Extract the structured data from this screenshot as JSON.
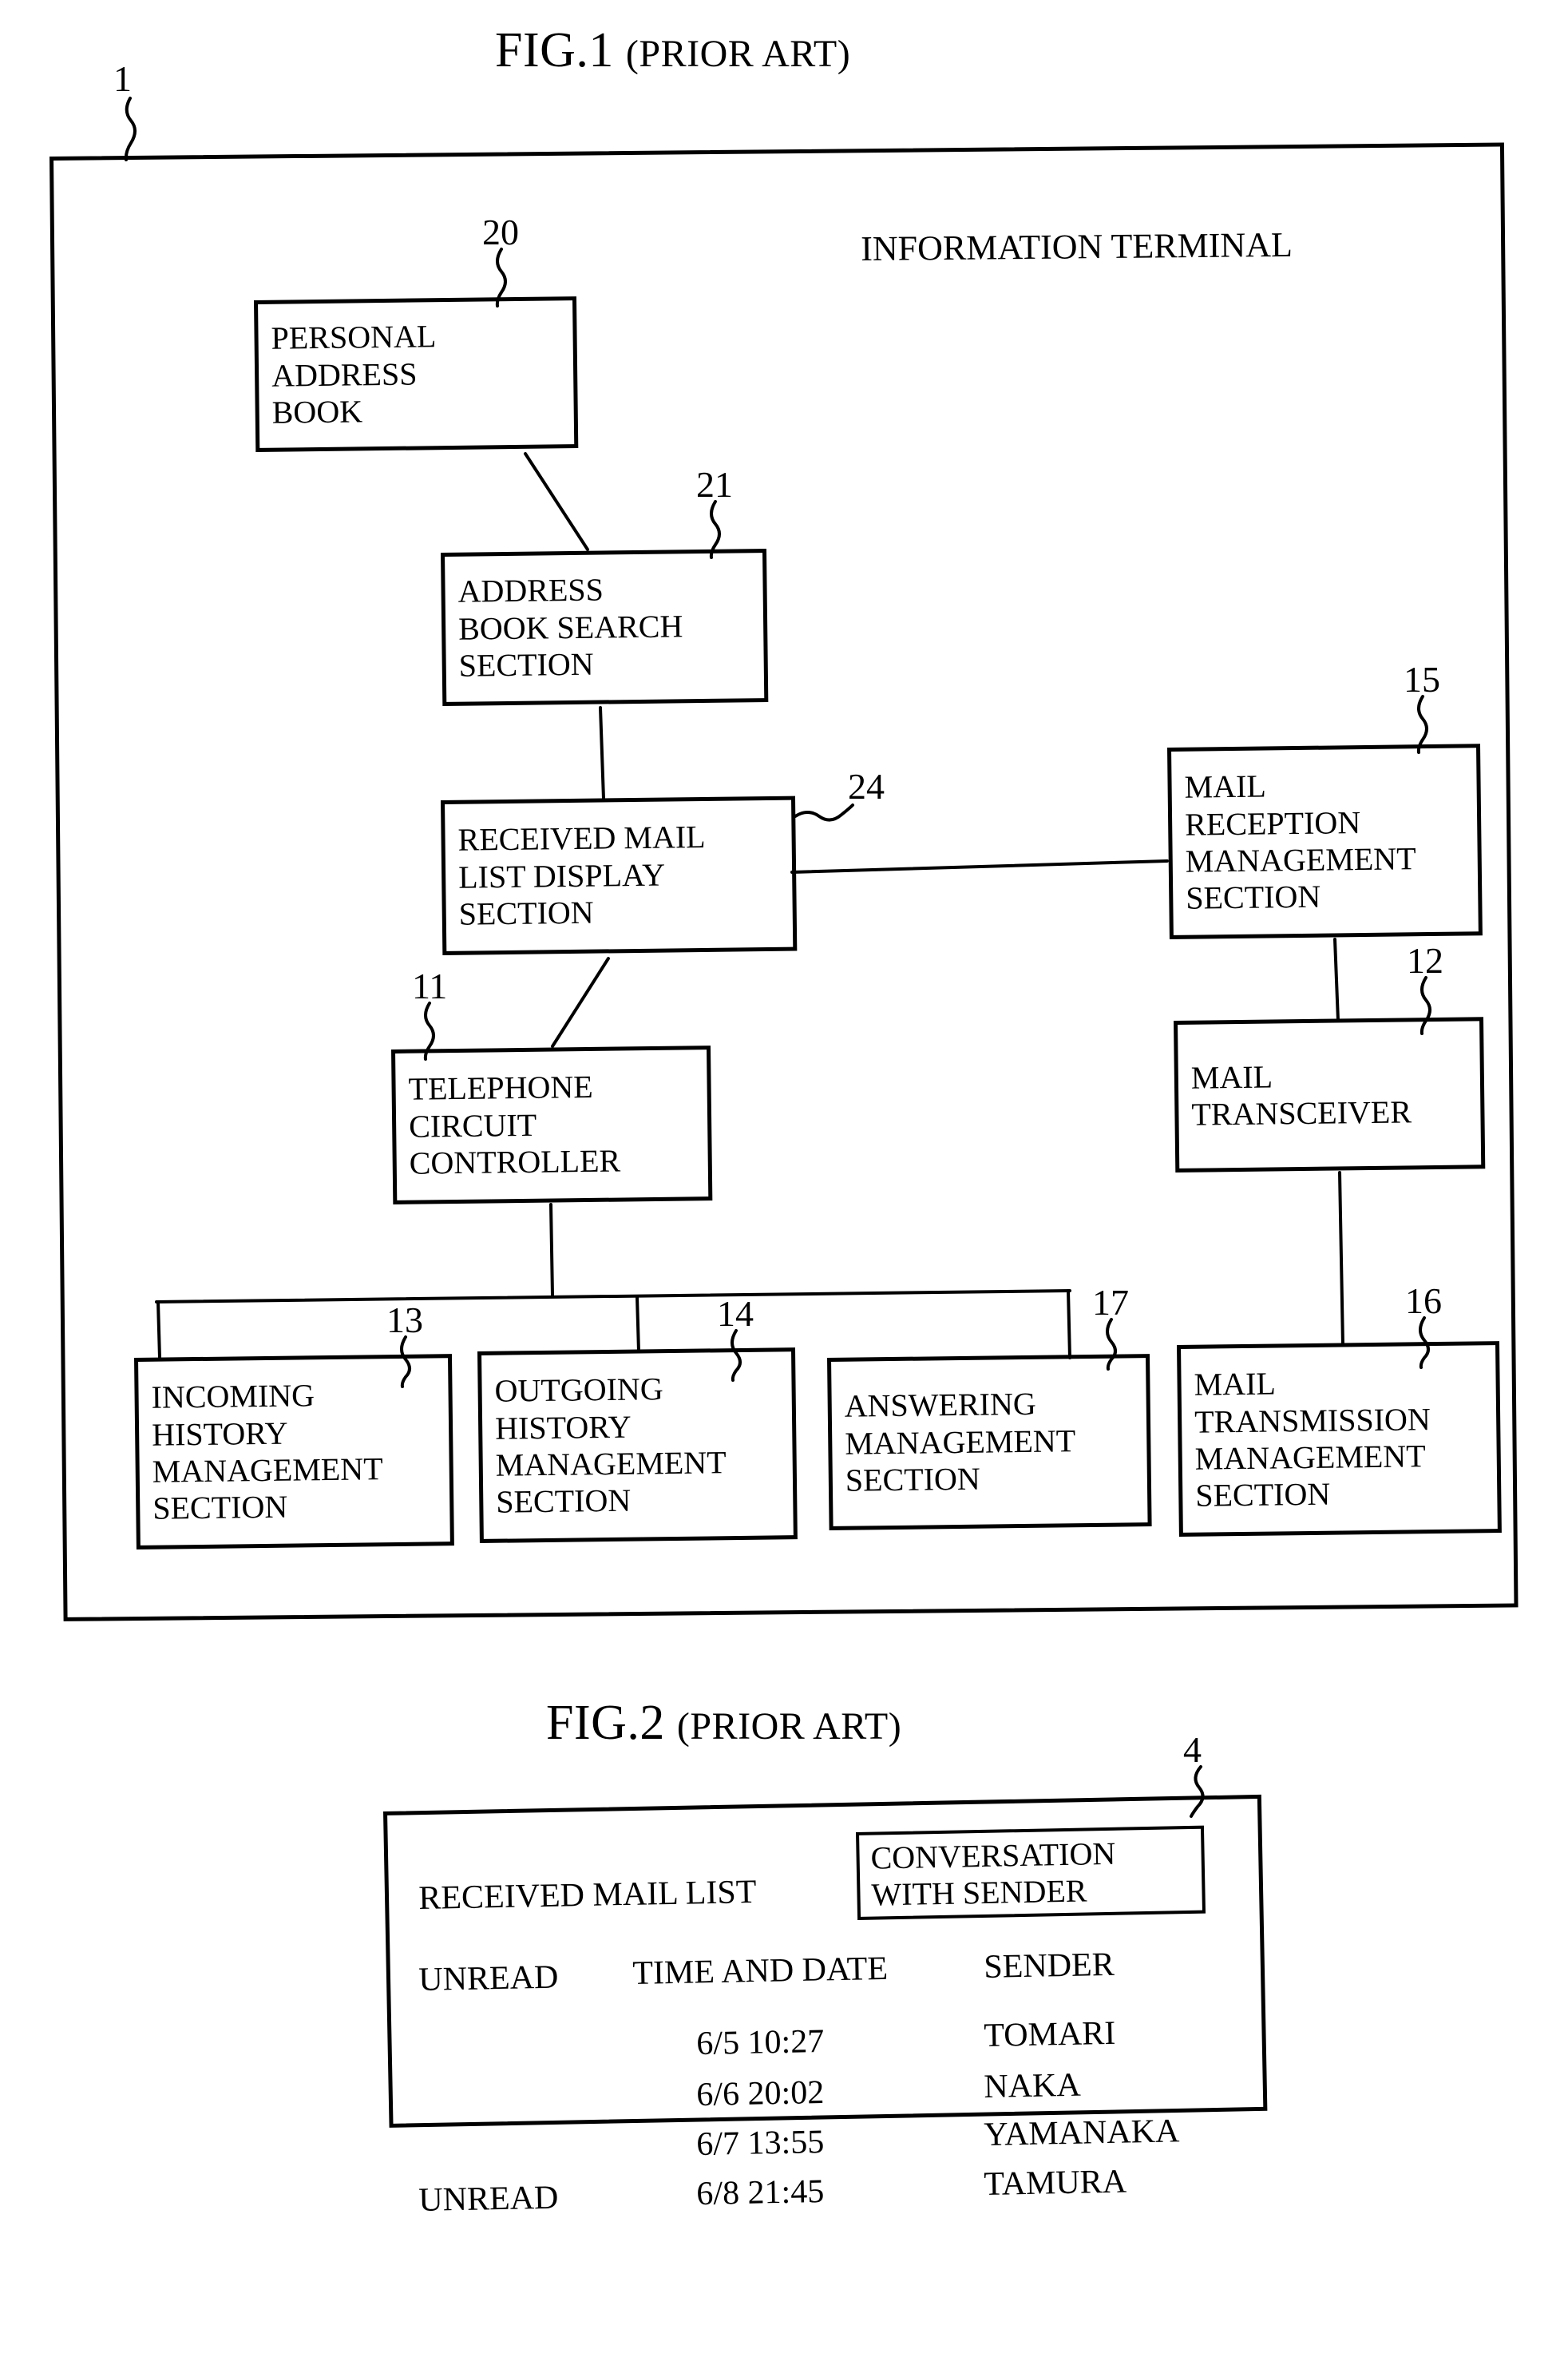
{
  "figures": [
    {
      "id": "fig1",
      "title_number": "FIG.1",
      "title_suffix": "(PRIOR ART)",
      "frame_ref": "1",
      "frame_label": "INFORMATION TERMINAL",
      "blocks": [
        {
          "ref": "20",
          "label": "PERSONAL\nADDRESS\nBOOK"
        },
        {
          "ref": "21",
          "label": "ADDRESS\nBOOK SEARCH\nSECTION"
        },
        {
          "ref": "24",
          "label": "RECEIVED MAIL\nLIST DISPLAY\nSECTION"
        },
        {
          "ref": "15",
          "label": "MAIL\nRECEPTION\nMANAGEMENT\nSECTION"
        },
        {
          "ref": "11",
          "label": "TELEPHONE\nCIRCUIT\nCONTROLLER"
        },
        {
          "ref": "12",
          "label": "MAIL\nTRANSCEIVER"
        },
        {
          "ref": "13",
          "label": "INCOMING\nHISTORY\nMANAGEMENT\nSECTION"
        },
        {
          "ref": "14",
          "label": "OUTGOING\nHISTORY\nMANAGEMENT\nSECTION"
        },
        {
          "ref": "17",
          "label": "ANSWERING\nMANAGEMENT\nSECTION"
        },
        {
          "ref": "16",
          "label": "MAIL\nTRANSMISSION\nMANAGEMENT\nSECTION"
        }
      ]
    },
    {
      "id": "fig2",
      "title_number": "FIG.2",
      "title_suffix": "(PRIOR ART)",
      "frame_ref": "4",
      "screen": {
        "heading": "RECEIVED MAIL LIST",
        "button_label": "CONVERSATION\nWITH SENDER",
        "columns": [
          "UNREAD",
          "TIME AND DATE",
          "SENDER"
        ],
        "rows": [
          {
            "unread": "",
            "time_and_date": "6/5 10:27",
            "sender": "TOMARI"
          },
          {
            "unread": "",
            "time_and_date": "6/6 20:02",
            "sender": "NAKA"
          },
          {
            "unread": "",
            "time_and_date": "6/7 13:55",
            "sender": "YAMANAKA"
          },
          {
            "unread": "UNREAD",
            "time_and_date": "6/8 21:45",
            "sender": "TAMURA"
          }
        ]
      }
    }
  ],
  "colors": {
    "ink": "#000000",
    "paper": "#ffffff"
  }
}
